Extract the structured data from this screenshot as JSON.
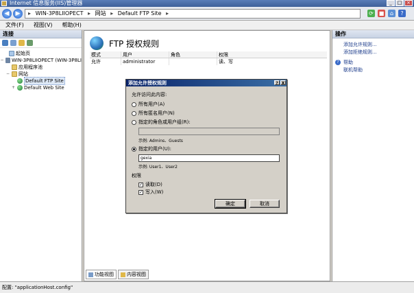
{
  "window": {
    "title": "Internet 信息服务(IIS)管理器"
  },
  "address": {
    "segments": [
      "WIN-3P8LIIOPECT",
      "网站",
      "Default FTP Site"
    ]
  },
  "menu": [
    "文件(F)",
    "视图(V)",
    "帮助(H)"
  ],
  "left": {
    "header": "连接",
    "tree": [
      {
        "label": "起始页",
        "icon": "home-icon",
        "indent": 1,
        "twisty": ""
      },
      {
        "label": "WIN-3P8LIIOPECT (WIN-3P8LI",
        "icon": "server-icon",
        "indent": 0,
        "twisty": "-"
      },
      {
        "label": "应用程序池",
        "icon": "folder-icon",
        "indent": 1,
        "twisty": ""
      },
      {
        "label": "网站",
        "icon": "folder-icon",
        "indent": 1,
        "twisty": "-"
      },
      {
        "label": "Default FTP Site",
        "icon": "globe-icon",
        "indent": 2,
        "twisty": "",
        "selected": true
      },
      {
        "label": "Default Web Site",
        "icon": "globe-icon",
        "indent": 2,
        "twisty": "+"
      }
    ]
  },
  "main": {
    "title": "FTP 授权规则",
    "columns": [
      "模式",
      "用户",
      "角色",
      "权限"
    ],
    "rows": [
      [
        "允许",
        "administrator",
        "",
        "读、写"
      ]
    ],
    "view_tabs": [
      "功能视图",
      "内容视图"
    ]
  },
  "actions": {
    "header": "操作",
    "items": [
      "添加允许规则...",
      "添加拒绝规则..."
    ],
    "help": [
      "帮助",
      "联机帮助"
    ]
  },
  "dialog": {
    "title": "添加允许授权规则",
    "help_btn": "?",
    "close_btn": "X",
    "prompt": "允许访问此内容:",
    "opt_all_users": "所有用户(A)",
    "opt_anon": "所有匿名用户(N)",
    "opt_roles": "指定的角色或用户组(R):",
    "roles_value": "",
    "roles_example": "示例: Admins、Guests",
    "opt_users": "指定的用户(U):",
    "users_value": "gexia",
    "users_example": "示例: User1、User2",
    "perm_label": "权限",
    "perm_read": "读取(D)",
    "perm_write": "写入(W)",
    "ok": "确定",
    "cancel": "取消"
  },
  "status": {
    "text": "配置: \"applicationHost.config\""
  }
}
